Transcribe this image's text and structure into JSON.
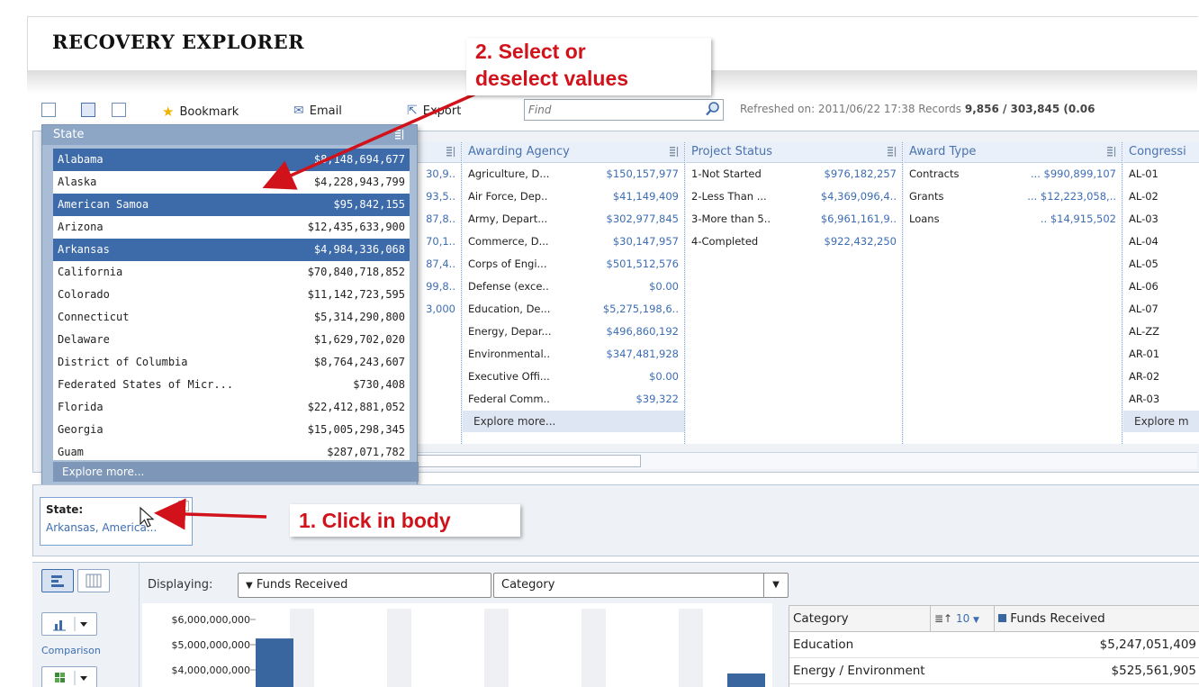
{
  "app": {
    "title": "RECOVERY EXPLORER"
  },
  "toolbar": {
    "bookmark": "Bookmark",
    "email": "Email",
    "export": "Export",
    "search_placeholder": "Find",
    "refresh_prefix": "Refreshed on: 2011/06/22 17:38 Records ",
    "records_count": "9,856 / 303,845",
    "records_pct": " (0.06"
  },
  "state_facet": {
    "title": "State",
    "items": [
      {
        "label": "Alabama",
        "value": "$8,148,694,677",
        "selected": true
      },
      {
        "label": "Alaska",
        "value": "$4,228,943,799",
        "selected": false
      },
      {
        "label": "American Samoa",
        "value": "$95,842,155",
        "selected": true
      },
      {
        "label": "Arizona",
        "value": "$12,435,633,900",
        "selected": false
      },
      {
        "label": "Arkansas",
        "value": "$4,984,336,068",
        "selected": true
      },
      {
        "label": "California",
        "value": "$70,840,718,852",
        "selected": false
      },
      {
        "label": "Colorado",
        "value": "$11,142,723,595",
        "selected": false
      },
      {
        "label": "Connecticut",
        "value": "$5,314,290,800",
        "selected": false
      },
      {
        "label": "Delaware",
        "value": "$1,629,702,020",
        "selected": false
      },
      {
        "label": "District of Columbia",
        "value": "$8,764,243,607",
        "selected": false
      },
      {
        "label": "Federated States of Micr...",
        "value": "$730,408",
        "selected": false
      },
      {
        "label": "Florida",
        "value": "$22,412,881,052",
        "selected": false
      },
      {
        "label": "Georgia",
        "value": "$15,005,298,345",
        "selected": false
      },
      {
        "label": "Guam",
        "value": "$287,071,782",
        "selected": false
      }
    ],
    "explore_more": "Explore more..."
  },
  "hidden_col": {
    "values": [
      "30,9..",
      "93,5..",
      "87,8..",
      "70,1..",
      "87,4..",
      "99,8..",
      "3,000"
    ]
  },
  "awarding_agency": {
    "title": "Awarding Agency",
    "items": [
      {
        "label": "Agriculture, D...",
        "value": "$150,157,977"
      },
      {
        "label": "Air Force, Dep..",
        "value": "$41,149,409"
      },
      {
        "label": "Army, Depart...",
        "value": "$302,977,845"
      },
      {
        "label": "Commerce, D...",
        "value": "$30,147,957"
      },
      {
        "label": "Corps of Engi...",
        "value": "$501,512,576"
      },
      {
        "label": "Defense (exce..",
        "value": "$0.00"
      },
      {
        "label": "Education, De...",
        "value": "$5,275,198,6.."
      },
      {
        "label": "Energy, Depar...",
        "value": "$496,860,192"
      },
      {
        "label": "Environmental..",
        "value": "$347,481,928"
      },
      {
        "label": "Executive Offi...",
        "value": "$0.00"
      },
      {
        "label": "Federal Comm..",
        "value": "$39,322"
      }
    ],
    "explore_more": "Explore more..."
  },
  "project_status": {
    "title": "Project Status",
    "items": [
      {
        "label": "1-Not Started",
        "value": "$976,182,257"
      },
      {
        "label": "2-Less Than ...",
        "value": "$4,369,096,4.."
      },
      {
        "label": "3-More than 5..",
        "value": "$6,961,161,9.."
      },
      {
        "label": "4-Completed",
        "value": "$922,432,250"
      }
    ]
  },
  "award_type": {
    "title": "Award Type",
    "items": [
      {
        "label": "Contracts",
        "value": "... $990,899,107"
      },
      {
        "label": "Grants",
        "value": "... $12,223,058,.."
      },
      {
        "label": "Loans",
        "value": ".. $14,915,502"
      }
    ]
  },
  "congressional": {
    "title": "Congressi",
    "items": [
      "AL-01",
      "AL-02",
      "AL-03",
      "AL-04",
      "AL-05",
      "AL-06",
      "AL-07",
      "AL-ZZ",
      "AR-01",
      "AR-02",
      "AR-03"
    ],
    "explore_more": "Explore m"
  },
  "selection": {
    "title": "State:",
    "value": "Arkansas, America..."
  },
  "chart_panel": {
    "displaying_label": "Displaying:",
    "measure": "Funds Received",
    "dimension": "Category",
    "comparison_label": "Comparison",
    "y_ticks": [
      "$6,000,000,000",
      "$5,000,000,000",
      "$4,000,000,000"
    ]
  },
  "chart_data": {
    "type": "bar",
    "categories": [
      "Education",
      "Energy / Environment"
    ],
    "values": [
      5247051409,
      525561905
    ],
    "title": "",
    "xlabel": "",
    "ylabel": "",
    "ylim": [
      4000000000,
      6000000000
    ]
  },
  "table": {
    "header_category": "Category",
    "header_count": "10",
    "header_measure": "Funds Received",
    "rows": [
      {
        "category": "Education",
        "value": "$5,247,051,409"
      },
      {
        "category": "Energy / Environment",
        "value": "$525,561,905"
      }
    ]
  },
  "callouts": {
    "step1": "1. Click in body",
    "step2_line1": "2. Select or",
    "step2_line2": "deselect values"
  },
  "colors": {
    "selected_row": "#3d6aa8",
    "value_text": "#3d6db3",
    "callout_text": "#d1121b",
    "bar": "#3a66a0"
  }
}
